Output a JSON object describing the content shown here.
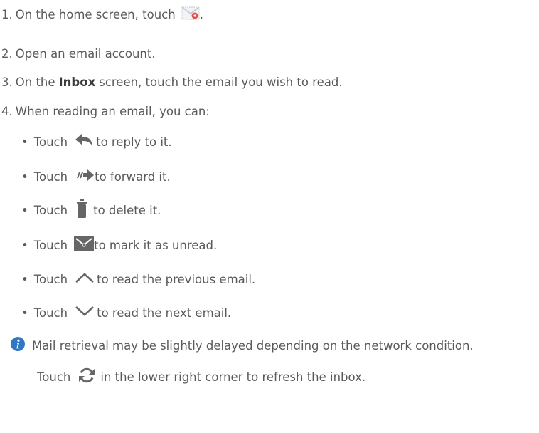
{
  "colors": {
    "text": "#5a5a5a",
    "icon": "#666666",
    "info": "#2f78c4"
  },
  "steps": [
    {
      "number": "1.",
      "before": "On the home screen, touch",
      "icon": "email-app-icon",
      "after": "."
    },
    {
      "number": "2.",
      "text": "Open an email account."
    },
    {
      "number": "3.",
      "before": "On the",
      "bold": "Inbox",
      "after": "screen, touch the email you wish to read."
    },
    {
      "number": "4.",
      "text": "When reading an email, you can:"
    }
  ],
  "actions": [
    {
      "bullet": "•",
      "lead": "Touch",
      "icon": "reply-icon",
      "text": "to reply to it."
    },
    {
      "bullet": "•",
      "lead": "Touch",
      "icon": "forward-icon",
      "text": "to forward it."
    },
    {
      "bullet": "•",
      "lead": "Touch",
      "icon": "trash-icon",
      "text": "to delete it."
    },
    {
      "bullet": "•",
      "lead": "Touch",
      "icon": "mark-unread-icon",
      "text": "to mark it as unread."
    },
    {
      "bullet": "•",
      "lead": "Touch",
      "icon": "chevron-up-icon",
      "text": "to read the previous email."
    },
    {
      "bullet": "•",
      "lead": "Touch",
      "icon": "chevron-down-icon",
      "text": "to read the next email."
    }
  ],
  "note": {
    "icon": "info-icon",
    "line1": "Mail retrieval may be slightly delayed depending on the network condition.",
    "line2_lead": "Touch",
    "line2_icon": "refresh-icon",
    "line2_text": "in the lower right corner to refresh the inbox."
  }
}
